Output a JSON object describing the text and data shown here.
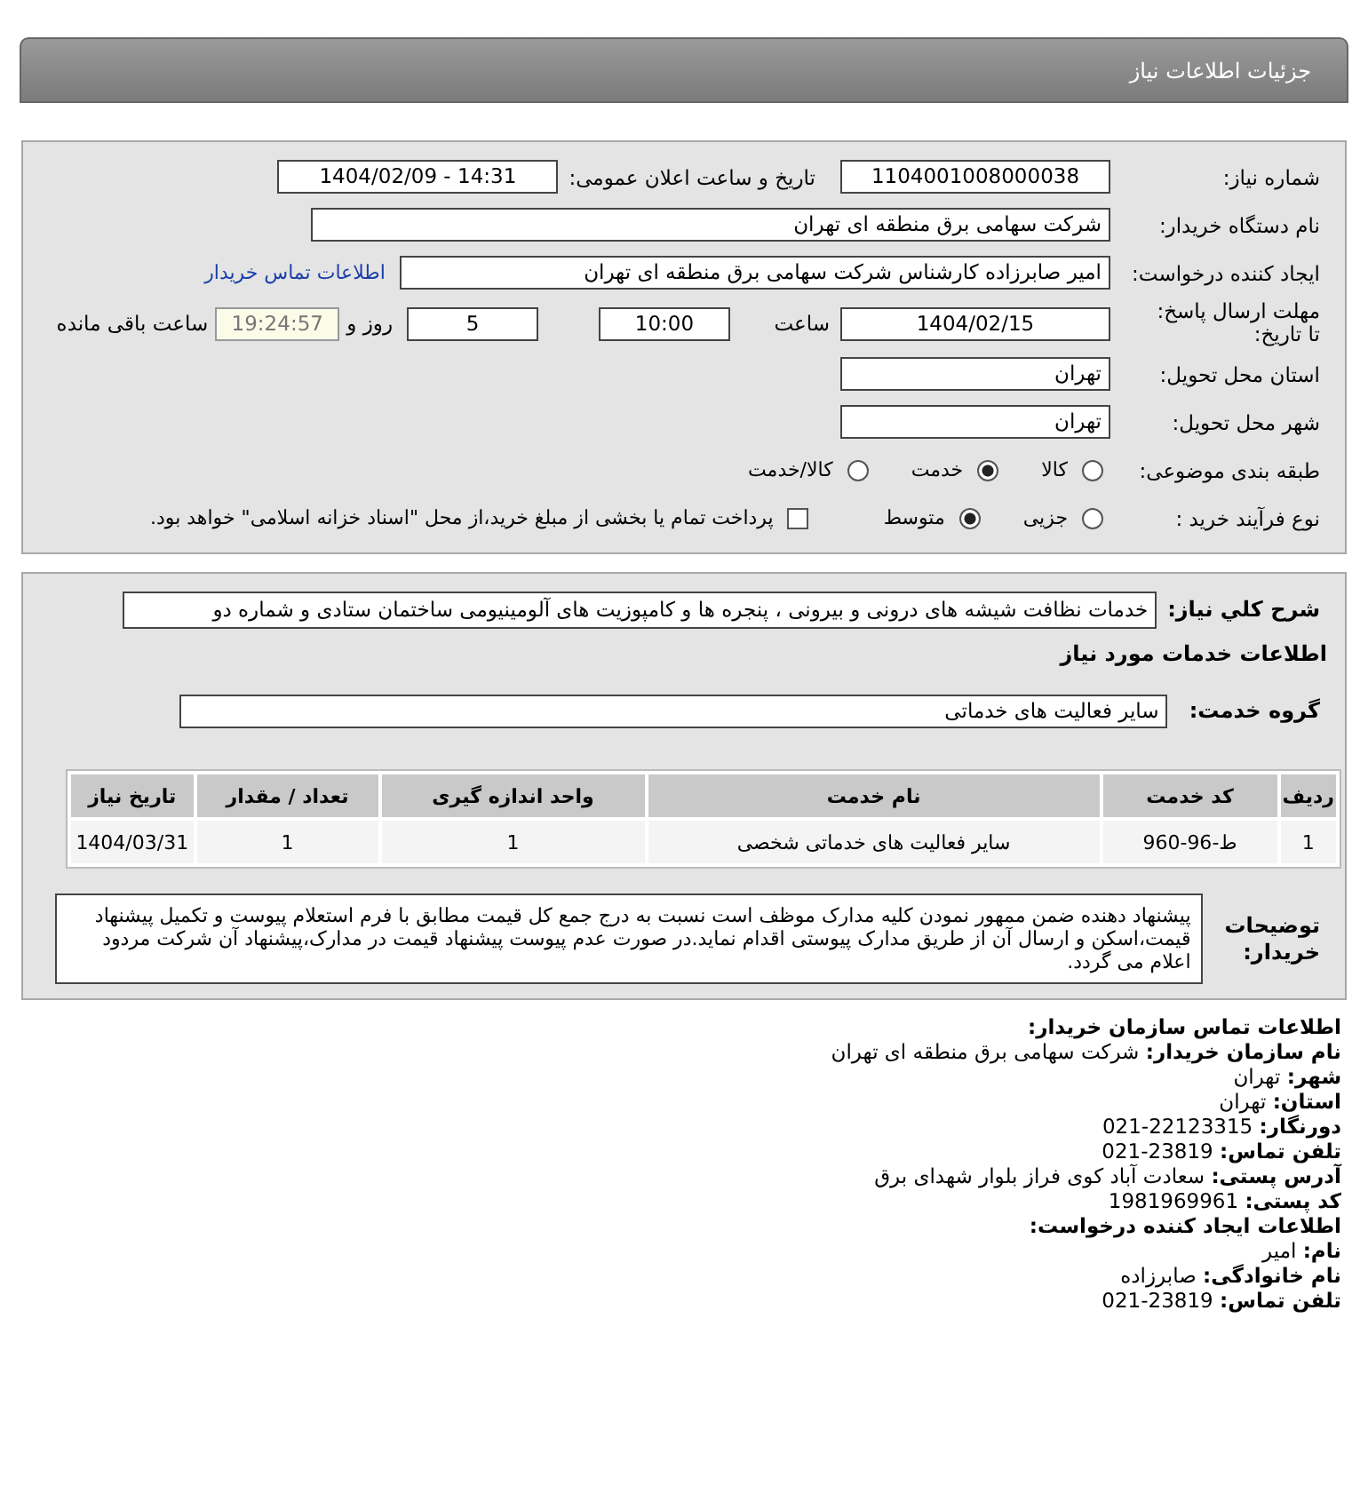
{
  "header": {
    "title": "جزئیات اطلاعات نیاز"
  },
  "details": {
    "need_number": {
      "label": "شماره نیاز:",
      "value": "1104001008000038"
    },
    "announce": {
      "label": "تاریخ و ساعت اعلان عمومی:",
      "value": "14:31 - 1404/02/09"
    },
    "buyer_org": {
      "label": "نام دستگاه خریدار:",
      "value": "شرکت سهامی برق منطقه ای تهران"
    },
    "requester": {
      "label": "ایجاد کننده درخواست:",
      "value": "امیر صابرزاده کارشناس شرکت سهامی برق منطقه ای تهران",
      "link": "اطلاعات تماس خریدار"
    },
    "deadline": {
      "label": "مهلت ارسال پاسخ: تا تاریخ:",
      "date": "1404/02/15",
      "time_label": "ساعت",
      "time": "10:00",
      "days": "5",
      "days_label": "روز و",
      "remaining": "19:24:57",
      "remaining_label": "ساعت باقی مانده"
    },
    "province": {
      "label": "استان محل تحویل:",
      "value": "تهران"
    },
    "city": {
      "label": "شهر محل تحویل:",
      "value": "تهران"
    },
    "category": {
      "label": "طبقه بندی موضوعی:",
      "options": [
        {
          "label": "کالا",
          "selected": false
        },
        {
          "label": "خدمت",
          "selected": true
        },
        {
          "label": "کالا/خدمت",
          "selected": false
        }
      ]
    },
    "process": {
      "label": "نوع فرآیند خرید :",
      "options": [
        {
          "label": "جزیی",
          "selected": false
        },
        {
          "label": "متوسط",
          "selected": true
        }
      ],
      "payment": {
        "checked": false,
        "label": "پرداخت تمام یا بخشی از مبلغ خرید،از محل \"اسناد خزانه اسلامی\" خواهد بود."
      }
    }
  },
  "services": {
    "summary": {
      "label": "شرح کلي نیاز:",
      "value": "خدمات نظافت شیشه های درونی و بیرونی ، پنجره ها و کامپوزیت های آلومینیومی ساختمان ستادی و شماره دو"
    },
    "title": "اطلاعات خدمات مورد نیاز",
    "group": {
      "label": "گروه خدمت:",
      "value": "سایر فعالیت های خدماتی"
    },
    "table": {
      "columns": [
        "ردیف",
        "کد خدمت",
        "نام خدمت",
        "واحد اندازه گیری",
        "تعداد / مقدار",
        "تاریخ نیاز"
      ],
      "rows": [
        [
          "1",
          "ط-96-960",
          "سایر فعالیت های خدماتی شخصی",
          "1",
          "1",
          "1404/03/31"
        ]
      ]
    },
    "notes": {
      "label": "توضیحات خریدار:",
      "value": "پیشنهاد دهنده ضمن ممهور نمودن کلیه مدارک موظف است نسبت به درج جمع کل قیمت مطابق با فرم استعلام پیوست و تکمیل پیشنهاد قیمت،اسکن و ارسال آن از طریق مدارک پیوستی اقدام نماید.در صورت عدم پیوست پیشنهاد قیمت در مدارک،پیشنهاد آن شرکت مردود اعلام می گردد."
    }
  },
  "contact": {
    "lines": [
      {
        "kind": "heading",
        "text": "اطلاعات تماس سازمان خریدار:"
      },
      {
        "kind": "field",
        "text": "**نام سازمان خریدار:** شرکت سهامی برق منطقه ای تهران"
      },
      {
        "kind": "field",
        "text": "**شهر:** تهران"
      },
      {
        "kind": "field",
        "text": "**استان:** تهران"
      },
      {
        "kind": "field",
        "text": "**دورنگار:** 22123315-021"
      },
      {
        "kind": "field",
        "text": "**تلفن تماس:** 23819-021"
      },
      {
        "kind": "field",
        "text": "**آدرس پستی:** سعادت آباد کوی فراز بلوار شهدای برق"
      },
      {
        "kind": "field",
        "text": "**کد پستی:** 1981969961"
      },
      {
        "kind": "heading",
        "text": "اطلاعات ایجاد کننده درخواست:"
      },
      {
        "kind": "field",
        "text": "**نام:** امیر"
      },
      {
        "kind": "field",
        "text": "**نام خانوادگی:** صابرزاده"
      },
      {
        "kind": "field",
        "text": "**تلفن تماس:** 23819-021"
      }
    ]
  }
}
